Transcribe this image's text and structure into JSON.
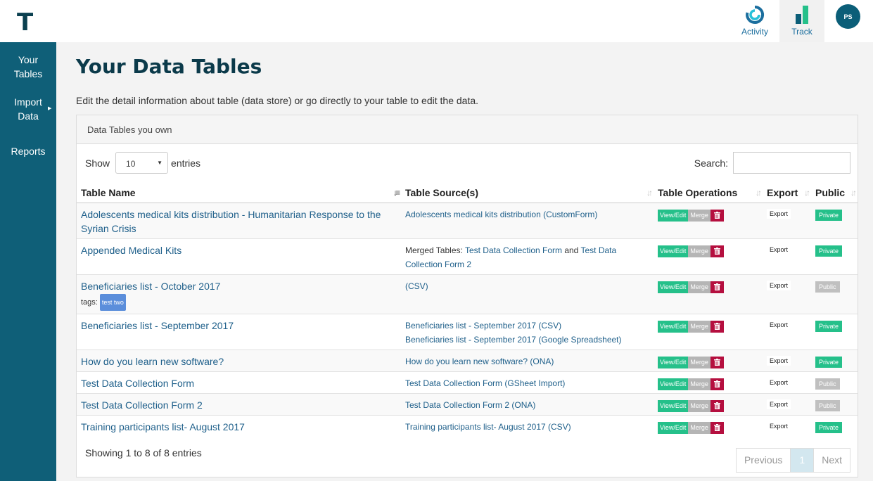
{
  "app": {
    "logo": "T"
  },
  "topnav": {
    "activity_label": "Activity",
    "track_label": "Track",
    "avatar_initials": "PS",
    "accent": "#0b5e78"
  },
  "sidebar": {
    "items": [
      {
        "label_line1": "Your",
        "label_line2": "Tables"
      },
      {
        "label_line1": "Import",
        "label_line2": "Data"
      },
      {
        "label_line1": "Reports",
        "label_line2": ""
      }
    ]
  },
  "page": {
    "title": "Your Data Tables",
    "description": "Edit the detail information about table (data store) or go directly to your table to edit the data."
  },
  "panel": {
    "heading": "Data Tables you own",
    "show_label": "Show",
    "entries_value": "10",
    "entries_label": "entries",
    "search_label": "Search:",
    "search_value": ""
  },
  "table": {
    "headers": [
      "Table Name",
      "Table Source(s)",
      "Table Operations",
      "Export",
      "Public"
    ],
    "buttons": {
      "view": "View/Edit",
      "merge": "Merge",
      "export": "Export"
    },
    "tags_label": "tags:",
    "rows": [
      {
        "name": "Adolescents medical kits distribution - Humanitarian Response to the Syrian Crisis",
        "source_html": [
          {
            "link": "Adolescents medical kits distribution (CustomForm)"
          }
        ],
        "visibility": "Private"
      },
      {
        "name": "Appended Medical Kits",
        "source_html": [
          {
            "plain": "Merged Tables: "
          },
          {
            "link": "Test Data Collection Form"
          },
          {
            "plain": " and "
          },
          {
            "link": "Test Data Collection Form 2"
          }
        ],
        "visibility": "Private"
      },
      {
        "name": "Beneficiaries list - October 2017",
        "tag": "test two",
        "source_html": [
          {
            "link": "(CSV)"
          }
        ],
        "visibility": "Public"
      },
      {
        "name": "Beneficiaries list - September 2017",
        "source_html": [
          {
            "link": "Beneficiaries list - September 2017 (CSV)"
          },
          {
            "br": true
          },
          {
            "link": "Beneficiaries list - September 2017 (Google Spreadsheet)"
          }
        ],
        "visibility": "Private"
      },
      {
        "name": "How do you learn new software?",
        "source_html": [
          {
            "link": "How do you learn new software? (ONA)"
          }
        ],
        "visibility": "Private"
      },
      {
        "name": "Test Data Collection Form",
        "source_html": [
          {
            "link": "Test Data Collection Form (GSheet Import)"
          }
        ],
        "visibility": "Public"
      },
      {
        "name": "Test Data Collection Form 2",
        "source_html": [
          {
            "link": "Test Data Collection Form 2 (ONA)"
          }
        ],
        "visibility": "Public"
      },
      {
        "name": "Training participants list- August 2017",
        "source_html": [
          {
            "link": "Training participants list- August 2017 (CSV)"
          }
        ],
        "visibility": "Private"
      }
    ]
  },
  "footer": {
    "info": "Showing 1 to 8 of 8 entries",
    "previous": "Previous",
    "current_page": "1",
    "next": "Next"
  }
}
